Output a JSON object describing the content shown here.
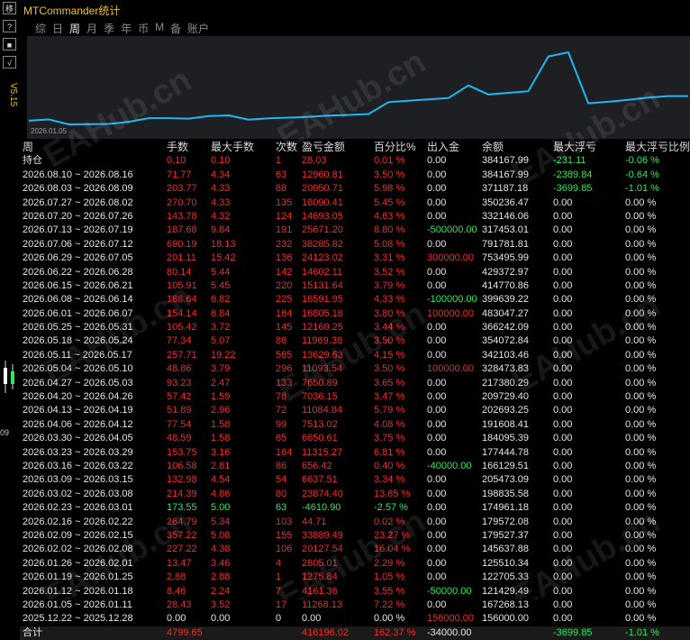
{
  "window": {
    "app_title": "MTCommander统计",
    "side_buttons": [
      "移",
      "?",
      "■",
      "√"
    ],
    "version": "V5.15",
    "edge_label": "09"
  },
  "tabs": [
    {
      "label": "综",
      "active": false
    },
    {
      "label": "日",
      "active": false
    },
    {
      "label": "周",
      "active": true
    },
    {
      "label": "月",
      "active": false
    },
    {
      "label": "季",
      "active": false
    },
    {
      "label": "年",
      "active": false
    },
    {
      "label": "币",
      "active": false
    },
    {
      "label": "M",
      "active": false
    },
    {
      "label": "备",
      "active": false
    },
    {
      "label": "账户",
      "active": false
    }
  ],
  "chart_data": {
    "type": "line",
    "x_start_label": "2026.01.05",
    "color": "#1fb6f2",
    "values": [
      156000,
      167268,
      121429,
      122705,
      125510,
      145637,
      179527,
      179572,
      174961,
      198835,
      205473,
      166129,
      177444,
      184095,
      191608,
      202693,
      209729,
      217380,
      328473,
      342103,
      354072,
      366242,
      483047,
      399639,
      414770,
      429372,
      753495,
      791781,
      317453,
      332146,
      350236,
      371187,
      384167,
      384167
    ]
  },
  "table": {
    "headers": [
      "周",
      "手数",
      "最大手数",
      "次数",
      "盈亏金额",
      "百分比%",
      "出入金",
      "余额",
      "最大浮亏",
      "最大浮亏比例"
    ],
    "rows": [
      {
        "period": "持仓",
        "lots": "0.10",
        "max_lots": "0.10",
        "count": "1",
        "pnl": "28.03",
        "pct": "0.01 %",
        "flow": "0.00",
        "balance": "384167.99",
        "max_dd": "-231.11",
        "max_dd_pct": "-0.06 %",
        "colors": [
          "w",
          "r",
          "r",
          "r",
          "r",
          "r",
          "w",
          "w",
          "g",
          "g"
        ]
      },
      {
        "period": "2026.08.10 ~ 2026.08.16",
        "lots": "71.77",
        "max_lots": "4.34",
        "count": "63",
        "pnl": "12960.81",
        "pct": "3.50 %",
        "flow": "0.00",
        "balance": "384167.99",
        "max_dd": "-2389.84",
        "max_dd_pct": "-0.64 %",
        "colors": [
          "w",
          "r",
          "r",
          "r",
          "r",
          "r",
          "w",
          "w",
          "g",
          "g"
        ]
      },
      {
        "period": "2026.08.03 ~ 2026.08.09",
        "lots": "203.77",
        "max_lots": "4.33",
        "count": "88",
        "pnl": "20950.71",
        "pct": "5.98 %",
        "flow": "0.00",
        "balance": "371187.18",
        "max_dd": "-3699.85",
        "max_dd_pct": "-1.01 %",
        "colors": [
          "w",
          "r",
          "r",
          "r",
          "r",
          "r",
          "w",
          "w",
          "g",
          "g"
        ]
      },
      {
        "period": "2026.07.27 ~ 2026.08.02",
        "lots": "270.70",
        "max_lots": "4.33",
        "count": "135",
        "pnl": "18090.41",
        "pct": "5.45 %",
        "flow": "0.00",
        "balance": "350236.47",
        "max_dd": "0.00",
        "max_dd_pct": "0.00 %",
        "colors": [
          "w",
          "r",
          "r",
          "r",
          "r",
          "r",
          "w",
          "w",
          "w",
          "w"
        ]
      },
      {
        "period": "2026.07.20 ~ 2026.07.26",
        "lots": "143.78",
        "max_lots": "4.32",
        "count": "124",
        "pnl": "14693.05",
        "pct": "4.63 %",
        "flow": "0.00",
        "balance": "332146.06",
        "max_dd": "0.00",
        "max_dd_pct": "0.00 %",
        "colors": [
          "w",
          "r",
          "r",
          "r",
          "r",
          "r",
          "w",
          "w",
          "w",
          "w"
        ]
      },
      {
        "period": "2026.07.13 ~ 2026.07.19",
        "lots": "187.68",
        "max_lots": "9.84",
        "count": "191",
        "pnl": "25671.20",
        "pct": "8.80 %",
        "flow": "-500000.00",
        "balance": "317453.01",
        "max_dd": "0.00",
        "max_dd_pct": "0.00 %",
        "colors": [
          "w",
          "r",
          "r",
          "r",
          "r",
          "r",
          "g",
          "w",
          "w",
          "w"
        ]
      },
      {
        "period": "2026.07.06 ~ 2026.07.12",
        "lots": "690.19",
        "max_lots": "18.13",
        "count": "232",
        "pnl": "38285.82",
        "pct": "5.08 %",
        "flow": "0.00",
        "balance": "791781.81",
        "max_dd": "0.00",
        "max_dd_pct": "0.00 %",
        "colors": [
          "w",
          "r",
          "r",
          "r",
          "r",
          "r",
          "w",
          "w",
          "w",
          "w"
        ]
      },
      {
        "period": "2026.06.29 ~ 2026.07.05",
        "lots": "201.11",
        "max_lots": "15.42",
        "count": "136",
        "pnl": "24123.02",
        "pct": "3.31 %",
        "flow": "300000.00",
        "balance": "753495.99",
        "max_dd": "0.00",
        "max_dd_pct": "0.00 %",
        "colors": [
          "w",
          "r",
          "r",
          "r",
          "r",
          "r",
          "r",
          "w",
          "w",
          "w"
        ]
      },
      {
        "period": "2026.06.22 ~ 2026.06.28",
        "lots": "80.14",
        "max_lots": "5.44",
        "count": "142",
        "pnl": "14602.11",
        "pct": "3.52 %",
        "flow": "0.00",
        "balance": "429372.97",
        "max_dd": "0.00",
        "max_dd_pct": "0.00 %",
        "colors": [
          "w",
          "r",
          "r",
          "r",
          "r",
          "r",
          "w",
          "w",
          "w",
          "w"
        ]
      },
      {
        "period": "2026.06.15 ~ 2026.06.21",
        "lots": "105.91",
        "max_lots": "5.45",
        "count": "220",
        "pnl": "15131.64",
        "pct": "3.79 %",
        "flow": "0.00",
        "balance": "414770.86",
        "max_dd": "0.00",
        "max_dd_pct": "0.00 %",
        "colors": [
          "w",
          "r",
          "r",
          "r",
          "r",
          "r",
          "w",
          "w",
          "w",
          "w"
        ]
      },
      {
        "period": "2026.06.08 ~ 2026.06.14",
        "lots": "188.64",
        "max_lots": "6.82",
        "count": "225",
        "pnl": "16591.95",
        "pct": "4.33 %",
        "flow": "-100000.00",
        "balance": "399639.22",
        "max_dd": "0.00",
        "max_dd_pct": "0.00 %",
        "colors": [
          "w",
          "r",
          "r",
          "r",
          "r",
          "r",
          "g",
          "w",
          "w",
          "w"
        ]
      },
      {
        "period": "2026.06.01 ~ 2026.06.07",
        "lots": "154.14",
        "max_lots": "6.84",
        "count": "164",
        "pnl": "16805.18",
        "pct": "3.80 %",
        "flow": "100000.00",
        "balance": "483047.27",
        "max_dd": "0.00",
        "max_dd_pct": "0.00 %",
        "colors": [
          "w",
          "r",
          "r",
          "r",
          "r",
          "r",
          "r",
          "w",
          "w",
          "w"
        ]
      },
      {
        "period": "2026.05.25 ~ 2026.05.31",
        "lots": "105.42",
        "max_lots": "3.72",
        "count": "145",
        "pnl": "12169.25",
        "pct": "3.44 %",
        "flow": "0.00",
        "balance": "366242.09",
        "max_dd": "0.00",
        "max_dd_pct": "0.00 %",
        "colors": [
          "w",
          "r",
          "r",
          "r",
          "r",
          "r",
          "w",
          "w",
          "w",
          "w"
        ]
      },
      {
        "period": "2026.05.18 ~ 2026.05.24",
        "lots": "77.34",
        "max_lots": "5.07",
        "count": "86",
        "pnl": "11969.38",
        "pct": "3.50 %",
        "flow": "0.00",
        "balance": "354072.84",
        "max_dd": "0.00",
        "max_dd_pct": "0.00 %",
        "colors": [
          "w",
          "r",
          "r",
          "r",
          "r",
          "r",
          "w",
          "w",
          "w",
          "w"
        ]
      },
      {
        "period": "2026.05.11 ~ 2026.05.17",
        "lots": "257.71",
        "max_lots": "19.22",
        "count": "565",
        "pnl": "13629.63",
        "pct": "4.15 %",
        "flow": "0.00",
        "balance": "342103.46",
        "max_dd": "0.00",
        "max_dd_pct": "0.00 %",
        "colors": [
          "w",
          "r",
          "r",
          "r",
          "r",
          "r",
          "w",
          "w",
          "w",
          "w"
        ]
      },
      {
        "period": "2026.05.04 ~ 2026.05.10",
        "lots": "48.86",
        "max_lots": "3.79",
        "count": "296",
        "pnl": "11093.54",
        "pct": "3.50 %",
        "flow": "100000.00",
        "balance": "328473.83",
        "max_dd": "0.00",
        "max_dd_pct": "0.00 %",
        "colors": [
          "w",
          "r",
          "r",
          "r",
          "r",
          "r",
          "r",
          "w",
          "w",
          "w"
        ]
      },
      {
        "period": "2026.04.27 ~ 2026.05.03",
        "lots": "93.23",
        "max_lots": "2.47",
        "count": "133",
        "pnl": "7650.89",
        "pct": "3.65 %",
        "flow": "0.00",
        "balance": "217380.29",
        "max_dd": "0.00",
        "max_dd_pct": "0.00 %",
        "colors": [
          "w",
          "r",
          "r",
          "r",
          "r",
          "r",
          "w",
          "w",
          "w",
          "w"
        ]
      },
      {
        "period": "2026.04.20 ~ 2026.04.26",
        "lots": "57.42",
        "max_lots": "1.59",
        "count": "78",
        "pnl": "7036.15",
        "pct": "3.47 %",
        "flow": "0.00",
        "balance": "209729.40",
        "max_dd": "0.00",
        "max_dd_pct": "0.00 %",
        "colors": [
          "w",
          "r",
          "r",
          "r",
          "r",
          "r",
          "w",
          "w",
          "w",
          "w"
        ]
      },
      {
        "period": "2026.04.13 ~ 2026.04.19",
        "lots": "51.89",
        "max_lots": "2.96",
        "count": "72",
        "pnl": "11084.84",
        "pct": "5.79 %",
        "flow": "0.00",
        "balance": "202693.25",
        "max_dd": "0.00",
        "max_dd_pct": "0.00 %",
        "colors": [
          "w",
          "r",
          "r",
          "r",
          "r",
          "r",
          "w",
          "w",
          "w",
          "w"
        ]
      },
      {
        "period": "2026.04.06 ~ 2026.04.12",
        "lots": "77.54",
        "max_lots": "1.58",
        "count": "99",
        "pnl": "7513.02",
        "pct": "4.08 %",
        "flow": "0.00",
        "balance": "191608.41",
        "max_dd": "0.00",
        "max_dd_pct": "0.00 %",
        "colors": [
          "w",
          "r",
          "r",
          "r",
          "r",
          "r",
          "w",
          "w",
          "w",
          "w"
        ]
      },
      {
        "period": "2026.03.30 ~ 2026.04.05",
        "lots": "48.59",
        "max_lots": "1.58",
        "count": "65",
        "pnl": "6650.61",
        "pct": "3.75 %",
        "flow": "0.00",
        "balance": "184095.39",
        "max_dd": "0.00",
        "max_dd_pct": "0.00 %",
        "colors": [
          "w",
          "r",
          "r",
          "r",
          "r",
          "r",
          "w",
          "w",
          "w",
          "w"
        ]
      },
      {
        "period": "2026.03.23 ~ 2026.03.29",
        "lots": "153.75",
        "max_lots": "3.16",
        "count": "164",
        "pnl": "11315.27",
        "pct": "6.81 %",
        "flow": "0.00",
        "balance": "177444.78",
        "max_dd": "0.00",
        "max_dd_pct": "0.00 %",
        "colors": [
          "w",
          "r",
          "r",
          "r",
          "r",
          "r",
          "w",
          "w",
          "w",
          "w"
        ]
      },
      {
        "period": "2026.03.16 ~ 2026.03.22",
        "lots": "106.58",
        "max_lots": "2.81",
        "count": "86",
        "pnl": "656.42",
        "pct": "0.40 %",
        "flow": "-40000.00",
        "balance": "166129.51",
        "max_dd": "0.00",
        "max_dd_pct": "0.00 %",
        "colors": [
          "w",
          "r",
          "r",
          "r",
          "r",
          "r",
          "g",
          "w",
          "w",
          "w"
        ]
      },
      {
        "period": "2026.03.09 ~ 2026.03.15",
        "lots": "132.98",
        "max_lots": "4.54",
        "count": "54",
        "pnl": "6637.51",
        "pct": "3.34 %",
        "flow": "0.00",
        "balance": "205473.09",
        "max_dd": "0.00",
        "max_dd_pct": "0.00 %",
        "colors": [
          "w",
          "r",
          "r",
          "r",
          "r",
          "r",
          "w",
          "w",
          "w",
          "w"
        ]
      },
      {
        "period": "2026.03.02 ~ 2026.03.08",
        "lots": "214.39",
        "max_lots": "4.86",
        "count": "80",
        "pnl": "23874.40",
        "pct": "13.65 %",
        "flow": "0.00",
        "balance": "198835.58",
        "max_dd": "0.00",
        "max_dd_pct": "0.00 %",
        "colors": [
          "w",
          "r",
          "r",
          "r",
          "r",
          "r",
          "w",
          "w",
          "w",
          "w"
        ]
      },
      {
        "period": "2026.02.23 ~ 2026.03.01",
        "lots": "173.55",
        "max_lots": "5.00",
        "count": "63",
        "pnl": "-4610.90",
        "pct": "-2.57 %",
        "flow": "0.00",
        "balance": "174961.18",
        "max_dd": "0.00",
        "max_dd_pct": "0.00 %",
        "colors": [
          "w",
          "g",
          "g",
          "g",
          "g",
          "g",
          "w",
          "w",
          "w",
          "w"
        ]
      },
      {
        "period": "2026.02.16 ~ 2026.02.22",
        "lots": "264.79",
        "max_lots": "5.34",
        "count": "103",
        "pnl": "44.71",
        "pct": "0.02 %",
        "flow": "0.00",
        "balance": "179572.08",
        "max_dd": "0.00",
        "max_dd_pct": "0.00 %",
        "colors": [
          "w",
          "r",
          "r",
          "r",
          "r",
          "r",
          "w",
          "w",
          "w",
          "w"
        ]
      },
      {
        "period": "2026.02.09 ~ 2026.02.15",
        "lots": "357.22",
        "max_lots": "5.08",
        "count": "155",
        "pnl": "33889.49",
        "pct": "23.27 %",
        "flow": "0.00",
        "balance": "179527.37",
        "max_dd": "0.00",
        "max_dd_pct": "0.00 %",
        "colors": [
          "w",
          "r",
          "r",
          "r",
          "r",
          "r",
          "w",
          "w",
          "w",
          "w"
        ]
      },
      {
        "period": "2026.02.02 ~ 2026.02.08",
        "lots": "227.22",
        "max_lots": "4.38",
        "count": "106",
        "pnl": "20127.54",
        "pct": "16.04 %",
        "flow": "0.00",
        "balance": "145637.88",
        "max_dd": "0.00",
        "max_dd_pct": "0.00 %",
        "colors": [
          "w",
          "r",
          "r",
          "r",
          "r",
          "r",
          "w",
          "w",
          "w",
          "w"
        ]
      },
      {
        "period": "2026.01.26 ~ 2026.02.01",
        "lots": "13.47",
        "max_lots": "3.46",
        "count": "4",
        "pnl": "2805.01",
        "pct": "2.29 %",
        "flow": "0.00",
        "balance": "125510.34",
        "max_dd": "0.00",
        "max_dd_pct": "0.00 %",
        "colors": [
          "w",
          "r",
          "r",
          "r",
          "r",
          "r",
          "w",
          "w",
          "w",
          "w"
        ]
      },
      {
        "period": "2026.01.19 ~ 2026.01.25",
        "lots": "2.88",
        "max_lots": "2.88",
        "count": "1",
        "pnl": "1275.84",
        "pct": "1.05 %",
        "flow": "0.00",
        "balance": "122705.33",
        "max_dd": "0.00",
        "max_dd_pct": "0.00 %",
        "colors": [
          "w",
          "r",
          "r",
          "r",
          "r",
          "r",
          "w",
          "w",
          "w",
          "w"
        ]
      },
      {
        "period": "2026.01.12 ~ 2026.01.18",
        "lots": "8.46",
        "max_lots": "2.24",
        "count": "7",
        "pnl": "4161.36",
        "pct": "3.55 %",
        "flow": "-50000.00",
        "balance": "121429.49",
        "max_dd": "0.00",
        "max_dd_pct": "0.00 %",
        "colors": [
          "w",
          "r",
          "r",
          "r",
          "r",
          "r",
          "g",
          "w",
          "w",
          "w"
        ]
      },
      {
        "period": "2026.01.05 ~ 2026.01.11",
        "lots": "28.43",
        "max_lots": "3.52",
        "count": "17",
        "pnl": "11268.13",
        "pct": "7.22 %",
        "flow": "0.00",
        "balance": "167268.13",
        "max_dd": "0.00",
        "max_dd_pct": "0.00 %",
        "colors": [
          "w",
          "r",
          "r",
          "r",
          "r",
          "r",
          "w",
          "w",
          "w",
          "w"
        ]
      },
      {
        "period": "2025.12.22 ~ 2025.12.28",
        "lots": "0.00",
        "max_lots": "0.00",
        "count": "0",
        "pnl": "0.00",
        "pct": "0.00 %",
        "flow": "156000.00",
        "balance": "156000.00",
        "max_dd": "0.00",
        "max_dd_pct": "0.00 %",
        "colors": [
          "w",
          "w",
          "w",
          "w",
          "w",
          "w",
          "r",
          "w",
          "w",
          "w"
        ]
      }
    ],
    "total": {
      "period": "合计",
      "lots": "4799.65",
      "max_lots": "",
      "count": "",
      "pnl": "416196.02",
      "pct": "162.37 %",
      "flow": "-34000.00",
      "balance": "",
      "max_dd": "-3699.85",
      "max_dd_pct": "-1.01 %",
      "colors": [
        "w",
        "r",
        "w",
        "w",
        "r",
        "r",
        "w",
        "w",
        "g",
        "g"
      ]
    }
  },
  "colors": {
    "positive": "#f02b2b",
    "negative": "#2fe85a",
    "title": "#f0c030",
    "line": "#1fb6f2"
  }
}
